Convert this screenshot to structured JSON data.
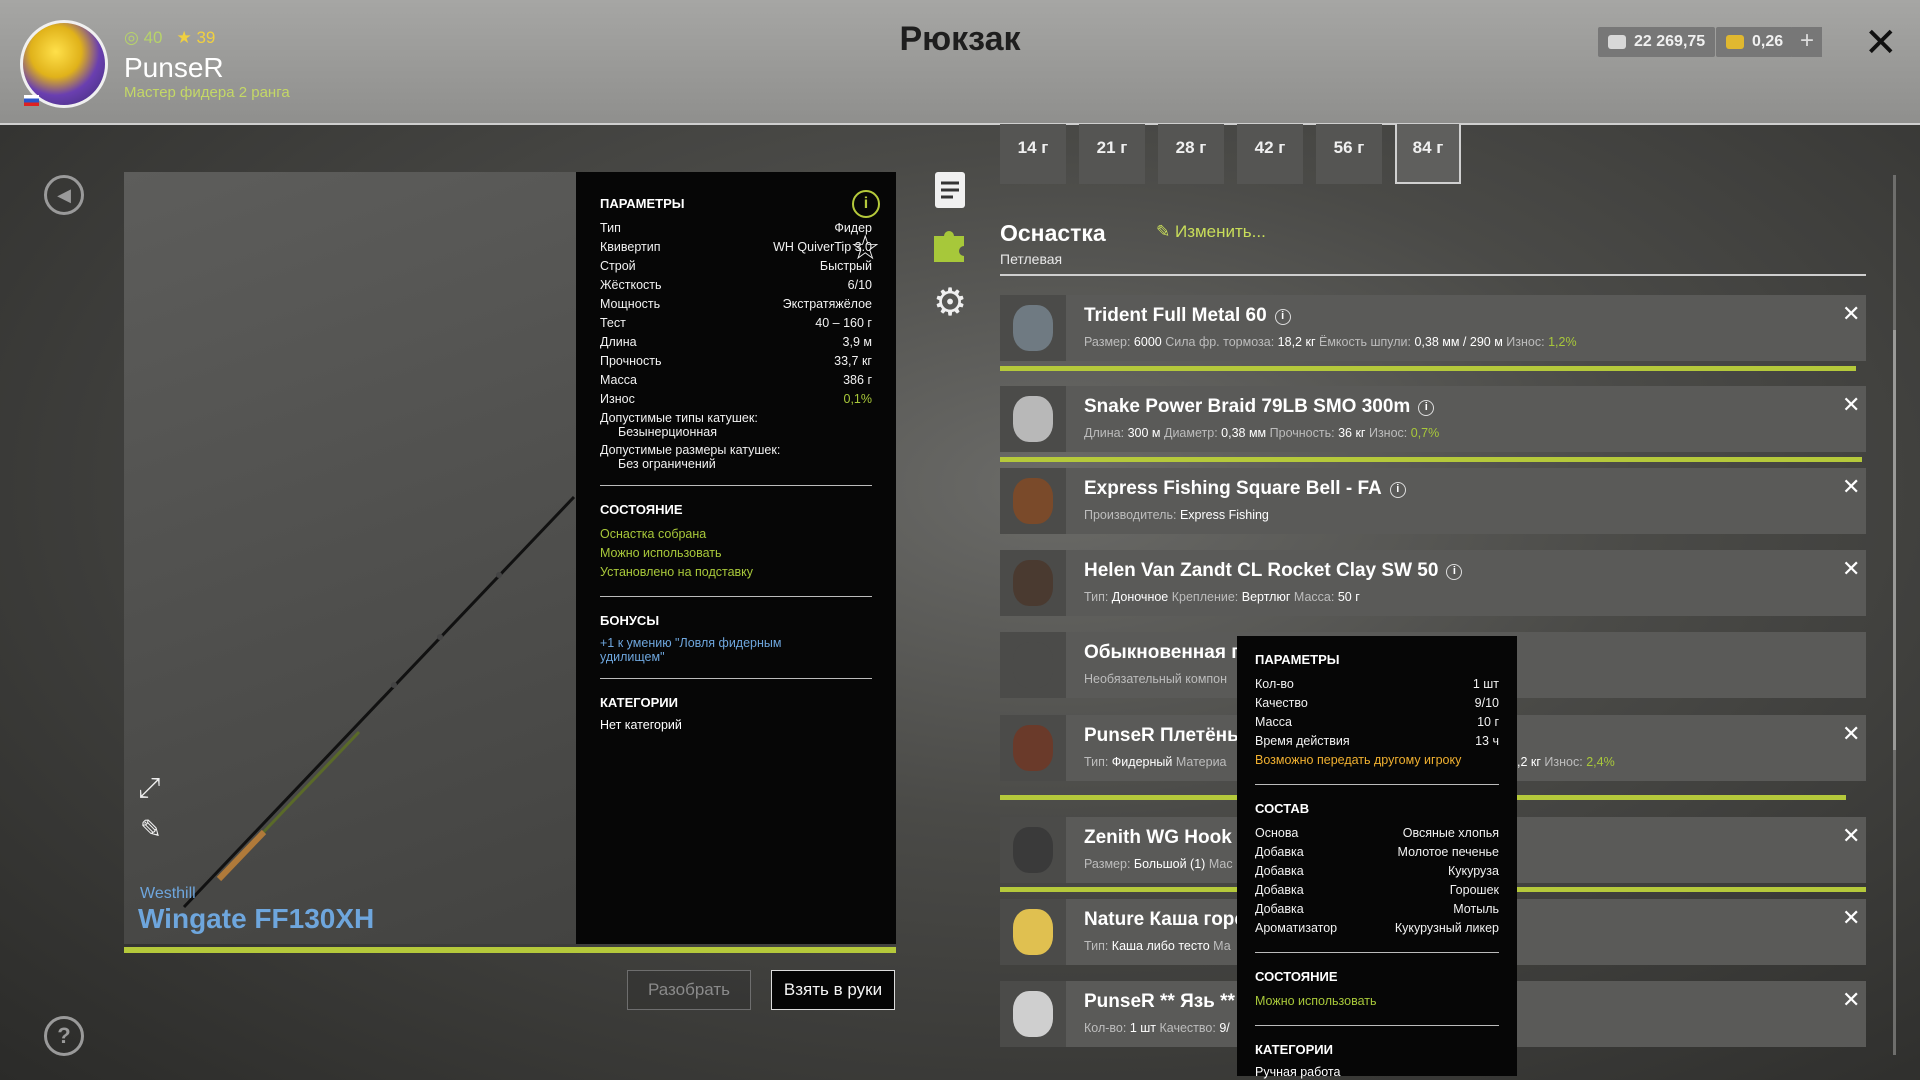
{
  "header": {
    "title": "Рюкзак",
    "player": {
      "exp": "40",
      "rank": "39",
      "name": "PunseR",
      "title": "Мастер фидера 2 ранга"
    },
    "silver": "22 269,75",
    "gold": "0,26",
    "plus": "+",
    "close": "✕"
  },
  "rod": {
    "maker": "Westhill",
    "name": "Wingate FF130XH"
  },
  "params": {
    "heading": "ПАРАМЕТРЫ",
    "rows": [
      {
        "k": "Тип",
        "v": "Фидер"
      },
      {
        "k": "Квивертип",
        "v": "WH QuiverTip 3.0"
      },
      {
        "k": "Строй",
        "v": "Быстрый"
      },
      {
        "k": "Жёсткость",
        "v": "6/10"
      },
      {
        "k": "Мощность",
        "v": "Экстратяжёлое"
      },
      {
        "k": "Тест",
        "v": "40 – 160 г"
      },
      {
        "k": "Длина",
        "v": "3,9 м"
      },
      {
        "k": "Прочность",
        "v": "33,7 кг"
      },
      {
        "k": "Масса",
        "v": "386 г"
      },
      {
        "k": "Износ",
        "v": "0,1%"
      }
    ],
    "reel_types_label": "Допустимые типы катушек:",
    "reel_types_value": "Безынерционная",
    "reel_sizes_label": "Допустимые размеры катушек:",
    "reel_sizes_value": "Без ограничений",
    "state_heading": "СОСТОЯНИЕ",
    "state": [
      "Оснастка собрана",
      "Можно использовать",
      "Установлено на подставку"
    ],
    "bonus_heading": "БОНУСЫ",
    "bonus": "+1 к умению \"Ловля фидерным удилищем\"",
    "cat_heading": "КАТЕГОРИИ",
    "cat": "Нет категорий"
  },
  "buttons": {
    "disassemble": "Разобрать",
    "take": "Взять в руки"
  },
  "weights": [
    "14 г",
    "21 г",
    "28 г",
    "42 г",
    "56 г",
    "84 г"
  ],
  "rig": {
    "title": "Оснастка",
    "subtitle": "Петлевая",
    "change": "Изменить..."
  },
  "items": [
    {
      "name": "Trident Full Metal 60",
      "desc": [
        [
          "Размер:",
          "6000"
        ],
        [
          "Сила фр. тормоза:",
          "18,2 кг"
        ],
        [
          "Ёмкость шпули:",
          "0,38 мм / 290 м"
        ],
        [
          "Износ:",
          "1,2%"
        ]
      ]
    },
    {
      "name": "Snake Power Braid 79LB SMO 300m",
      "desc": [
        [
          "Длина:",
          "300 м"
        ],
        [
          "Диаметр:",
          "0,38 мм"
        ],
        [
          "Прочность:",
          "36 кг"
        ],
        [
          "Износ:",
          "0,7%"
        ]
      ]
    },
    {
      "name": "Express Fishing Square Bell - FA",
      "desc": [
        [
          "Производитель:",
          "Express Fishing"
        ]
      ]
    },
    {
      "name": "Helen Van Zandt CL Rocket Clay SW 50",
      "desc": [
        [
          "Тип:",
          "Доночное"
        ],
        [
          "Крепление:",
          "Вертлюг"
        ],
        [
          "Масса:",
          "50 г"
        ]
      ]
    },
    {
      "name": "Обыкновенная п",
      "desc": [
        [
          "Необязательный компон",
          ""
        ]
      ]
    },
    {
      "name": "PunseR Плетёный",
      "desc": [
        [
          "Тип:",
          "Фидерный"
        ],
        [
          "Материа",
          ""
        ]
      ],
      "tail_label": ",2 кг",
      "tail_wear_label": "Износ:",
      "tail_wear": "2,4%"
    },
    {
      "name": "Zenith WG Hook S",
      "desc": [
        [
          "Размер:",
          "Большой (1)"
        ],
        [
          "Мас",
          ""
        ]
      ]
    },
    {
      "name": "Nature Каша горс",
      "desc": [
        [
          "Тип:",
          "Каша либо тесто"
        ],
        [
          "Ма",
          ""
        ]
      ]
    },
    {
      "name": "PunseR ** Язь **",
      "desc": [
        [
          "Кол-во:",
          "1 шт"
        ],
        [
          "Качество:",
          "9/"
        ]
      ]
    }
  ],
  "tooltip": {
    "heading": "ПАРАМЕТРЫ",
    "rows": [
      {
        "k": "Кол-во",
        "v": "1 шт"
      },
      {
        "k": "Качество",
        "v": "9/10"
      },
      {
        "k": "Масса",
        "v": "10 г"
      },
      {
        "k": "Время действия",
        "v": "13 ч"
      }
    ],
    "transfer": "Возможно передать другому игроку",
    "comp_heading": "СОСТАВ",
    "comp": [
      {
        "k": "Основа",
        "v": "Овсяные хлопья"
      },
      {
        "k": "Добавка",
        "v": "Молотое печенье"
      },
      {
        "k": "Добавка",
        "v": "Кукуруза"
      },
      {
        "k": "Добавка",
        "v": "Горошек"
      },
      {
        "k": "Добавка",
        "v": "Мотыль"
      },
      {
        "k": "Ароматизатор",
        "v": "Кукурузный ликер"
      }
    ],
    "state_heading": "СОСТОЯНИЕ",
    "state": "Можно использовать",
    "cat_heading": "КАТЕГОРИИ",
    "cat": "Ручная работа"
  },
  "colors": {
    "accent": "#b5c93b",
    "link": "#6ea6dd",
    "orange": "#f0b030"
  }
}
